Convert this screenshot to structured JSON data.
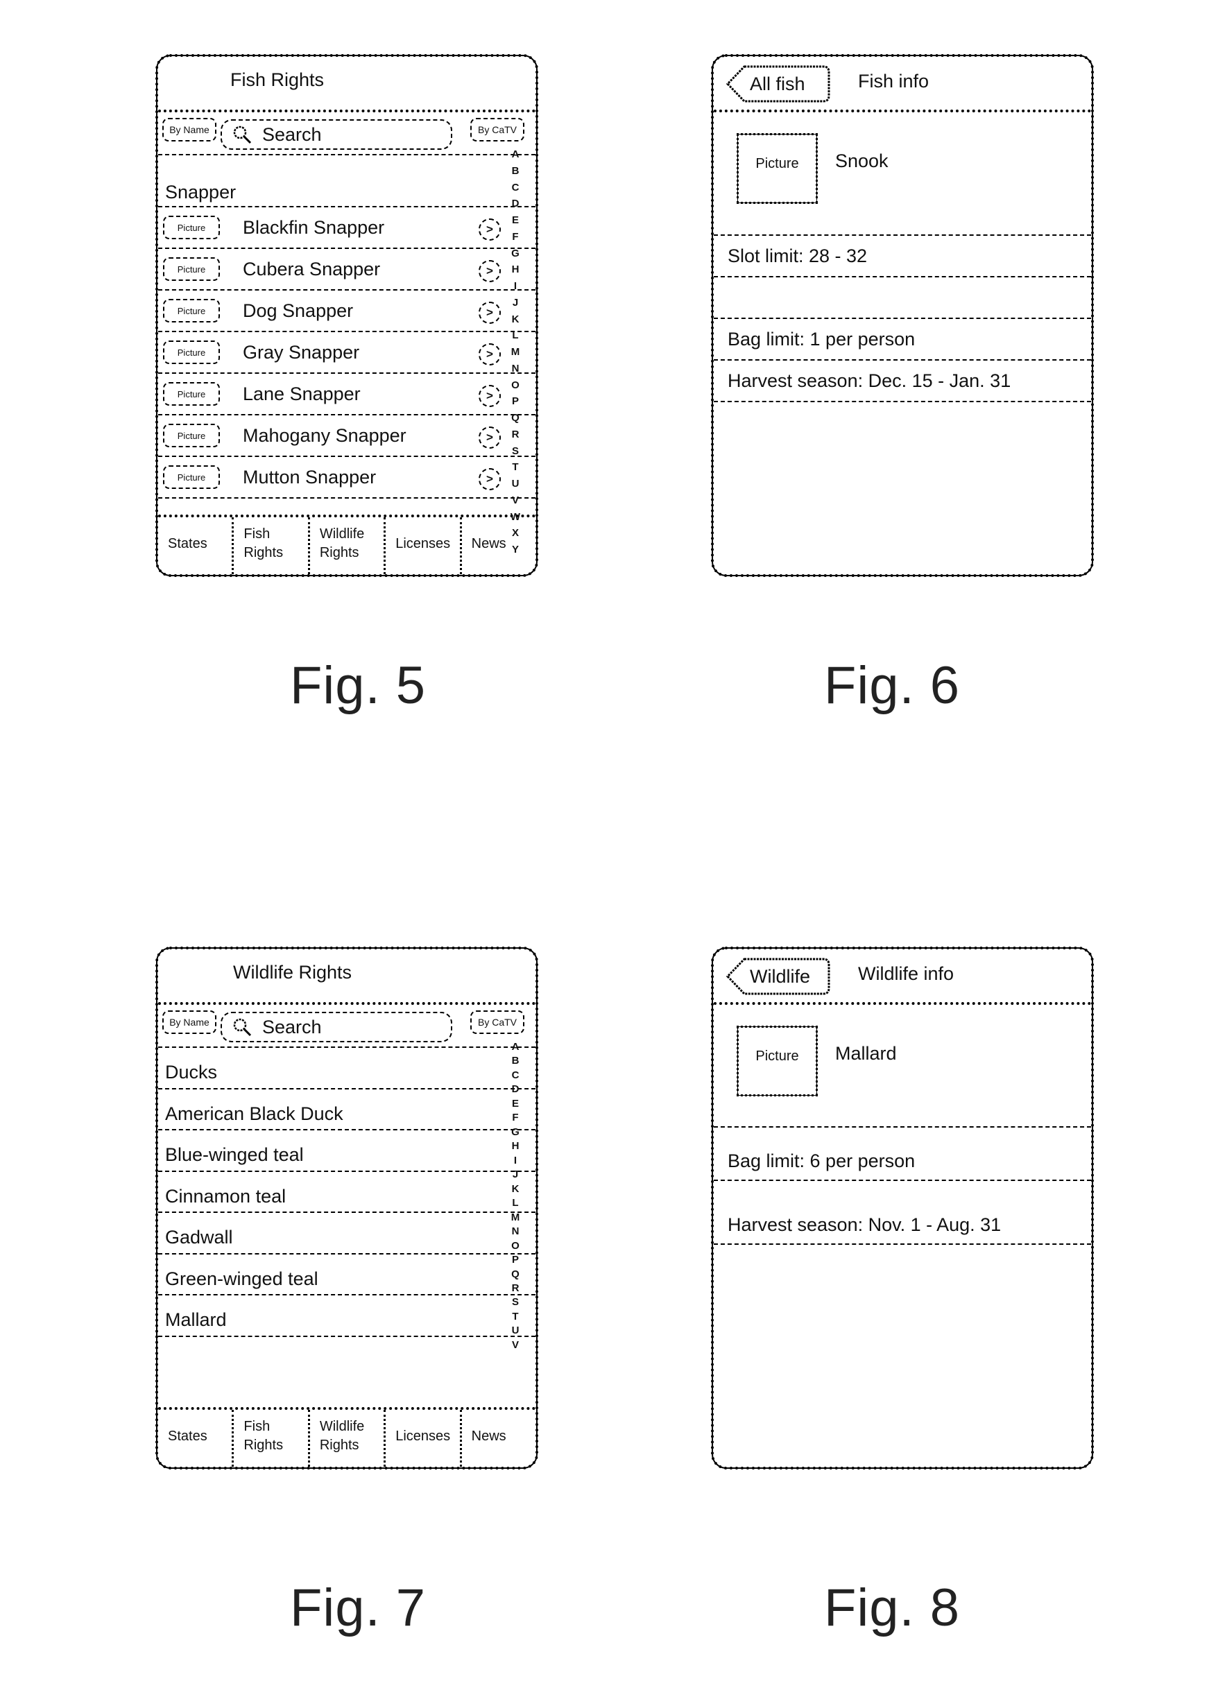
{
  "figures": {
    "fig5": {
      "label": "Fig. 5",
      "header_title": "Fish Rights",
      "by_name_label": "By Name",
      "search_placeholder": "Search",
      "by_catv_label": "By CaTV",
      "section_header": "Snapper",
      "index_letters": [
        "A",
        "B",
        "C",
        "D",
        "E",
        "F",
        "G",
        "H",
        "I",
        "J",
        "K",
        "L",
        "M",
        "N",
        "O",
        "P",
        "Q",
        "R",
        "S",
        "T",
        "U",
        "V",
        "W",
        "X",
        "Y"
      ],
      "picture_label": "Picture",
      "arrow_glyph": ">",
      "items": [
        {
          "name": "Blackfin Snapper"
        },
        {
          "name": "Cubera Snapper"
        },
        {
          "name": "Dog Snapper"
        },
        {
          "name": "Gray Snapper"
        },
        {
          "name": "Lane Snapper"
        },
        {
          "name": "Mahogany Snapper"
        },
        {
          "name": "Mutton Snapper"
        }
      ]
    },
    "fig6": {
      "label": "Fig. 6",
      "back_label": "All fish",
      "header_title": "Fish info",
      "picture_label": "Picture",
      "name": "Snook",
      "rows": [
        "Slot limit: 28 - 32",
        "",
        "Bag limit: 1 per person",
        "Harvest season: Dec. 15 - Jan. 31"
      ]
    },
    "fig7": {
      "label": "Fig. 7",
      "header_title": "Wildlife Rights",
      "by_name_label": "By Name",
      "search_placeholder": "Search",
      "by_catv_label": "By CaTV",
      "index_letters": [
        "A",
        "B",
        "C",
        "D",
        "E",
        "F",
        "G",
        "H",
        "I",
        "J",
        "K",
        "L",
        "M",
        "N",
        "O",
        "P",
        "Q",
        "R",
        "S",
        "T",
        "U",
        "V"
      ],
      "items": [
        {
          "name": "Ducks"
        },
        {
          "name": "American Black Duck"
        },
        {
          "name": "Blue-winged teal"
        },
        {
          "name": "Cinnamon teal"
        },
        {
          "name": "Gadwall"
        },
        {
          "name": "Green-winged teal"
        },
        {
          "name": "Mallard"
        }
      ]
    },
    "fig8": {
      "label": "Fig. 8",
      "back_label": "Wildlife",
      "header_title": "Wildlife info",
      "picture_label": "Picture",
      "name": "Mallard",
      "rows": [
        "Bag limit: 6 per person",
        "Harvest season: Nov. 1 - Aug. 31"
      ]
    }
  },
  "tabbar": {
    "tabs": [
      {
        "label_line1": "States",
        "label_line2": ""
      },
      {
        "label_line1": "Fish",
        "label_line2": "Rights"
      },
      {
        "label_line1": "Wildlife",
        "label_line2": "Rights"
      },
      {
        "label_line1": "Licenses",
        "label_line2": ""
      },
      {
        "label_line1": "News",
        "label_line2": ""
      }
    ]
  }
}
